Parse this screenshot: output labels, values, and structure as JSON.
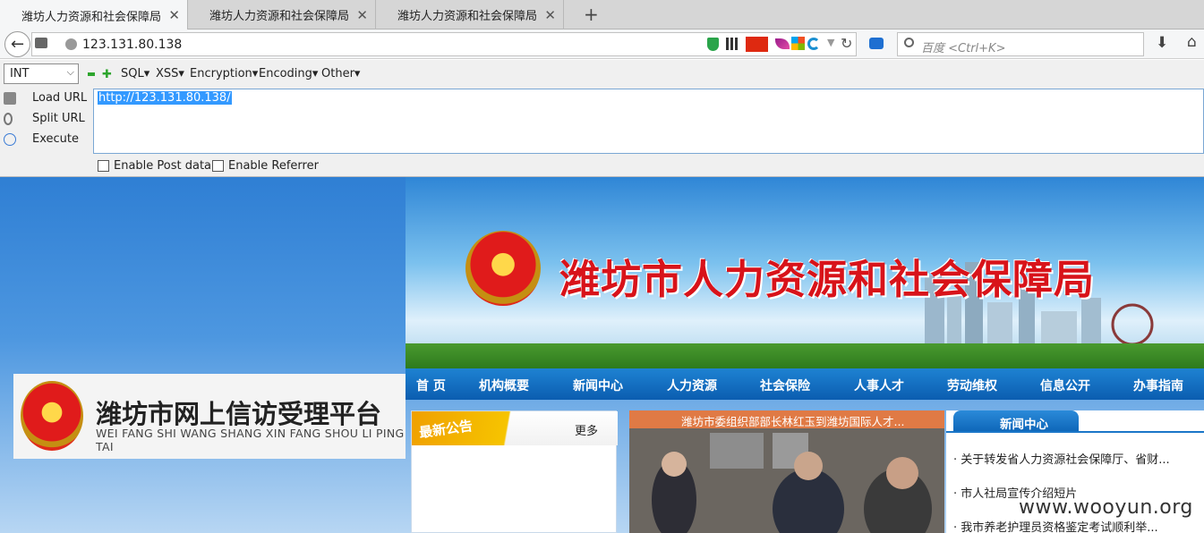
{
  "browser": {
    "tabs": [
      {
        "title": "潍坊人力资源和社会保障局",
        "close": "✕"
      },
      {
        "title": "潍坊人力资源和社会保障局",
        "close": "✕"
      },
      {
        "title": "潍坊人力资源和社会保障局",
        "close": "✕"
      }
    ],
    "new_tab": "+",
    "url": "123.131.80.138",
    "search_placeholder": "百度 <Ctrl+K>"
  },
  "hackbar": {
    "type_select": "INT",
    "menus": [
      "SQL▾",
      "XSS▾",
      "Encryption▾",
      "Encoding▾",
      "Other▾"
    ],
    "load_url": "Load URL",
    "split_url": "Split URL",
    "execute": "Execute",
    "url_value": "http://123.131.80.138/",
    "enable_post": "Enable Post data",
    "enable_referrer": "Enable Referrer"
  },
  "site": {
    "banner_title": "潍坊市人力资源和社会保障局",
    "nav": [
      "首 页",
      "机构概要",
      "新闻中心",
      "人力资源",
      "社会保险",
      "人事人才",
      "劳动维权",
      "信息公开",
      "办事指南"
    ],
    "platform_title": "潍坊市网上信访受理平台",
    "platform_subtitle": "WEI FANG SHI WANG SHANG XIN FANG SHOU LI PING TAI",
    "notice_title": "最新公告",
    "notice_more": "更多",
    "photo_caption": "潍坊市委组织部部长林红玉到潍坊国际人才...",
    "news_tab": "新闻中心",
    "news_items": [
      "· 关于转发省人力资源社会保障厅、省财...",
      "· 市人社局宣传介绍短片",
      "· 我市养老护理员资格鉴定考试顺利举..."
    ],
    "watermark": "www.wooyun.org"
  },
  "colors": {
    "accent": "#d8131a",
    "nav": "#0b5db0",
    "selection": "#3399ff"
  }
}
